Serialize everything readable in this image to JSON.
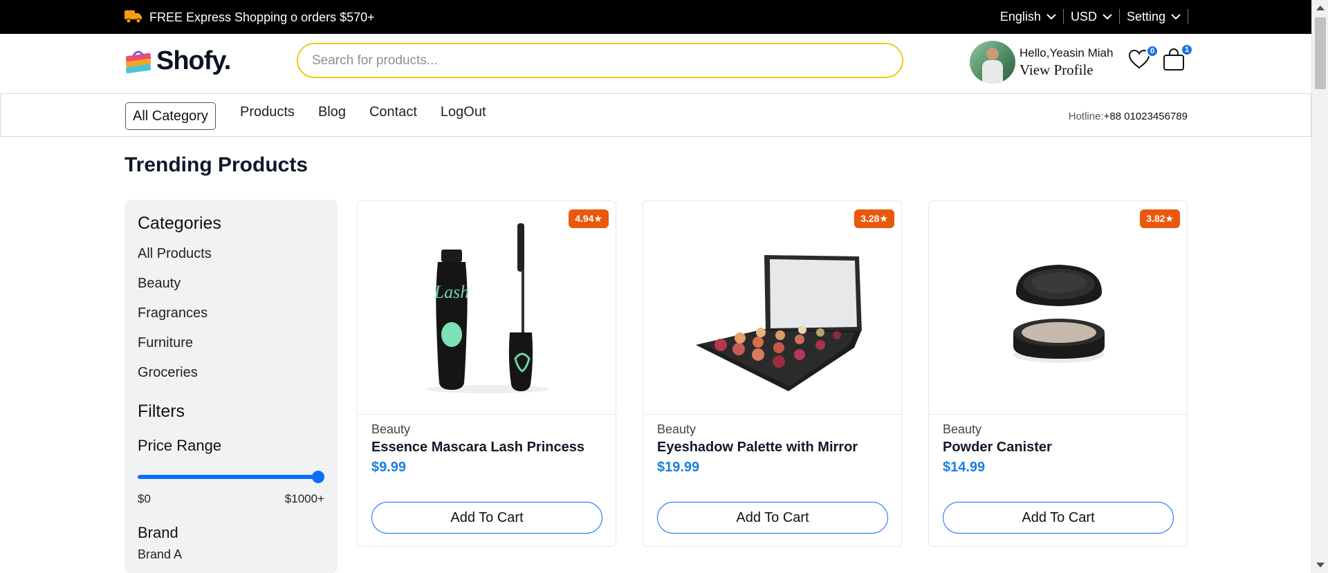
{
  "topbar": {
    "promo": "FREE Express Shopping o orders $570+",
    "language": "English",
    "currency": "USD",
    "setting": "Setting"
  },
  "header": {
    "logo": "Shofy.",
    "search_placeholder": "Search for products...",
    "greeting": "Hello,Yeasin Miah",
    "view_profile": "View Profile",
    "wishlist_count": "0",
    "cart_count": "1"
  },
  "nav": {
    "all_category": "All Category",
    "links": [
      "Products",
      "Blog",
      "Contact",
      "LogOut"
    ],
    "hotline_label": "Hotline:",
    "hotline_number": "+88 01023456789"
  },
  "section_title": "Trending Products",
  "sidebar": {
    "categories_title": "Categories",
    "categories": [
      "All Products",
      "Beauty",
      "Fragrances",
      "Furniture",
      "Groceries"
    ],
    "filters_title": "Filters",
    "price_range_title": "Price Range",
    "price_min": "$0",
    "price_max": "$1000+",
    "price_slider_value": 1.0,
    "brand_title": "Brand",
    "brands": [
      "Brand A"
    ]
  },
  "products": [
    {
      "rating": "4.94★",
      "category": "Beauty",
      "title": "Essence Mascara Lash Princess",
      "price": "$9.99",
      "button": "Add To Cart",
      "image_icon": "mascara-image"
    },
    {
      "rating": "3.28★",
      "category": "Beauty",
      "title": "Eyeshadow Palette with Mirror",
      "price": "$19.99",
      "button": "Add To Cart",
      "image_icon": "eyeshadow-palette-image"
    },
    {
      "rating": "3.82★",
      "category": "Beauty",
      "title": "Powder Canister",
      "price": "$14.99",
      "button": "Add To Cart",
      "image_icon": "powder-canister-image"
    }
  ],
  "colors": {
    "accent": "#0d6efd",
    "price": "#1a7fe0",
    "rating_badge": "#ea580c",
    "search_border": "#f5c518",
    "topbar": "#000000"
  }
}
